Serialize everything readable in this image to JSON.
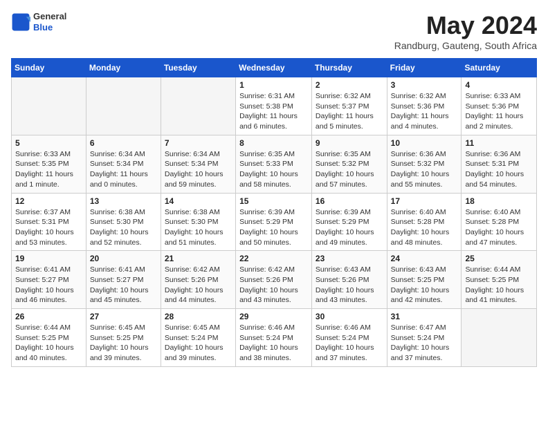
{
  "header": {
    "logo_general": "General",
    "logo_blue": "Blue",
    "month_year": "May 2024",
    "location": "Randburg, Gauteng, South Africa"
  },
  "days_of_week": [
    "Sunday",
    "Monday",
    "Tuesday",
    "Wednesday",
    "Thursday",
    "Friday",
    "Saturday"
  ],
  "weeks": [
    [
      {
        "day": "",
        "info": ""
      },
      {
        "day": "",
        "info": ""
      },
      {
        "day": "",
        "info": ""
      },
      {
        "day": "1",
        "info": "Sunrise: 6:31 AM\nSunset: 5:38 PM\nDaylight: 11 hours and 6 minutes."
      },
      {
        "day": "2",
        "info": "Sunrise: 6:32 AM\nSunset: 5:37 PM\nDaylight: 11 hours and 5 minutes."
      },
      {
        "day": "3",
        "info": "Sunrise: 6:32 AM\nSunset: 5:36 PM\nDaylight: 11 hours and 4 minutes."
      },
      {
        "day": "4",
        "info": "Sunrise: 6:33 AM\nSunset: 5:36 PM\nDaylight: 11 hours and 2 minutes."
      }
    ],
    [
      {
        "day": "5",
        "info": "Sunrise: 6:33 AM\nSunset: 5:35 PM\nDaylight: 11 hours and 1 minute."
      },
      {
        "day": "6",
        "info": "Sunrise: 6:34 AM\nSunset: 5:34 PM\nDaylight: 11 hours and 0 minutes."
      },
      {
        "day": "7",
        "info": "Sunrise: 6:34 AM\nSunset: 5:34 PM\nDaylight: 10 hours and 59 minutes."
      },
      {
        "day": "8",
        "info": "Sunrise: 6:35 AM\nSunset: 5:33 PM\nDaylight: 10 hours and 58 minutes."
      },
      {
        "day": "9",
        "info": "Sunrise: 6:35 AM\nSunset: 5:32 PM\nDaylight: 10 hours and 57 minutes."
      },
      {
        "day": "10",
        "info": "Sunrise: 6:36 AM\nSunset: 5:32 PM\nDaylight: 10 hours and 55 minutes."
      },
      {
        "day": "11",
        "info": "Sunrise: 6:36 AM\nSunset: 5:31 PM\nDaylight: 10 hours and 54 minutes."
      }
    ],
    [
      {
        "day": "12",
        "info": "Sunrise: 6:37 AM\nSunset: 5:31 PM\nDaylight: 10 hours and 53 minutes."
      },
      {
        "day": "13",
        "info": "Sunrise: 6:38 AM\nSunset: 5:30 PM\nDaylight: 10 hours and 52 minutes."
      },
      {
        "day": "14",
        "info": "Sunrise: 6:38 AM\nSunset: 5:30 PM\nDaylight: 10 hours and 51 minutes."
      },
      {
        "day": "15",
        "info": "Sunrise: 6:39 AM\nSunset: 5:29 PM\nDaylight: 10 hours and 50 minutes."
      },
      {
        "day": "16",
        "info": "Sunrise: 6:39 AM\nSunset: 5:29 PM\nDaylight: 10 hours and 49 minutes."
      },
      {
        "day": "17",
        "info": "Sunrise: 6:40 AM\nSunset: 5:28 PM\nDaylight: 10 hours and 48 minutes."
      },
      {
        "day": "18",
        "info": "Sunrise: 6:40 AM\nSunset: 5:28 PM\nDaylight: 10 hours and 47 minutes."
      }
    ],
    [
      {
        "day": "19",
        "info": "Sunrise: 6:41 AM\nSunset: 5:27 PM\nDaylight: 10 hours and 46 minutes."
      },
      {
        "day": "20",
        "info": "Sunrise: 6:41 AM\nSunset: 5:27 PM\nDaylight: 10 hours and 45 minutes."
      },
      {
        "day": "21",
        "info": "Sunrise: 6:42 AM\nSunset: 5:26 PM\nDaylight: 10 hours and 44 minutes."
      },
      {
        "day": "22",
        "info": "Sunrise: 6:42 AM\nSunset: 5:26 PM\nDaylight: 10 hours and 43 minutes."
      },
      {
        "day": "23",
        "info": "Sunrise: 6:43 AM\nSunset: 5:26 PM\nDaylight: 10 hours and 43 minutes."
      },
      {
        "day": "24",
        "info": "Sunrise: 6:43 AM\nSunset: 5:25 PM\nDaylight: 10 hours and 42 minutes."
      },
      {
        "day": "25",
        "info": "Sunrise: 6:44 AM\nSunset: 5:25 PM\nDaylight: 10 hours and 41 minutes."
      }
    ],
    [
      {
        "day": "26",
        "info": "Sunrise: 6:44 AM\nSunset: 5:25 PM\nDaylight: 10 hours and 40 minutes."
      },
      {
        "day": "27",
        "info": "Sunrise: 6:45 AM\nSunset: 5:25 PM\nDaylight: 10 hours and 39 minutes."
      },
      {
        "day": "28",
        "info": "Sunrise: 6:45 AM\nSunset: 5:24 PM\nDaylight: 10 hours and 39 minutes."
      },
      {
        "day": "29",
        "info": "Sunrise: 6:46 AM\nSunset: 5:24 PM\nDaylight: 10 hours and 38 minutes."
      },
      {
        "day": "30",
        "info": "Sunrise: 6:46 AM\nSunset: 5:24 PM\nDaylight: 10 hours and 37 minutes."
      },
      {
        "day": "31",
        "info": "Sunrise: 6:47 AM\nSunset: 5:24 PM\nDaylight: 10 hours and 37 minutes."
      },
      {
        "day": "",
        "info": ""
      }
    ]
  ]
}
